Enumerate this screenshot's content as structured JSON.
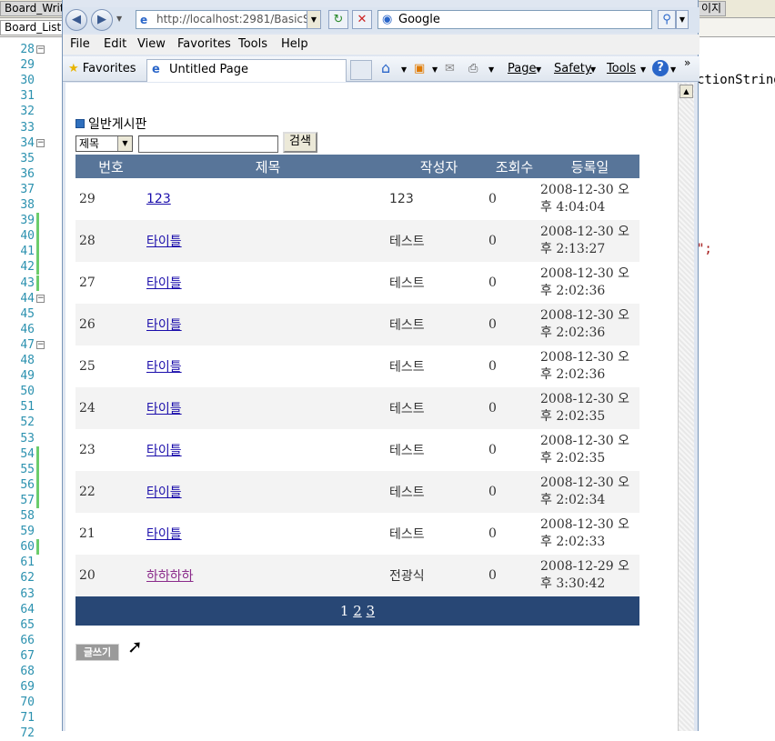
{
  "editor": {
    "tabs": [
      "Board_Writ",
      "Board_List"
    ],
    "right_tab": "이지",
    "line_numbers": [
      "28",
      "29",
      "30",
      "31",
      "32",
      "33",
      "34",
      "35",
      "36",
      "37",
      "38",
      "39",
      "40",
      "41",
      "42",
      "43",
      "44",
      "45",
      "46",
      "47",
      "48",
      "49",
      "50",
      "51",
      "52",
      "53",
      "54",
      "55",
      "56",
      "57",
      "58",
      "59",
      "60",
      "61",
      "62",
      "63",
      "64",
      "65",
      "66",
      "67",
      "68",
      "69",
      "70",
      "71",
      "72"
    ],
    "code_fragment_1": "ctionString",
    "code_fragment_2": "\";"
  },
  "browser": {
    "address": "http://localhost:2981/BasicS",
    "search_text": "Google",
    "menu": [
      "File",
      "Edit",
      "View",
      "Favorites",
      "Tools",
      "Help"
    ],
    "favorites_label": "Favorites",
    "tab_title": "Untitled Page",
    "command_bar": [
      "Page",
      "Safety",
      "Tools"
    ]
  },
  "board": {
    "title": "일반게시판",
    "search_field_option": "제목",
    "search_button": "검색",
    "columns": [
      "번호",
      "제목",
      "작성자",
      "조회수",
      "등록일"
    ],
    "rows": [
      {
        "num": "29",
        "title": "123",
        "writer": "123",
        "hits": "0",
        "date": "2008-12-30 오후 4:04:04"
      },
      {
        "num": "28",
        "title": "타이틀",
        "writer": "테스트",
        "hits": "0",
        "date": "2008-12-30 오후 2:13:27"
      },
      {
        "num": "27",
        "title": "타이틀",
        "writer": "테스트",
        "hits": "0",
        "date": "2008-12-30 오후 2:02:36"
      },
      {
        "num": "26",
        "title": "타이틀",
        "writer": "테스트",
        "hits": "0",
        "date": "2008-12-30 오후 2:02:36"
      },
      {
        "num": "25",
        "title": "타이틀",
        "writer": "테스트",
        "hits": "0",
        "date": "2008-12-30 오후 2:02:36"
      },
      {
        "num": "24",
        "title": "타이틀",
        "writer": "테스트",
        "hits": "0",
        "date": "2008-12-30 오후 2:02:35"
      },
      {
        "num": "23",
        "title": "타이틀",
        "writer": "테스트",
        "hits": "0",
        "date": "2008-12-30 오후 2:02:35"
      },
      {
        "num": "22",
        "title": "타이틀",
        "writer": "테스트",
        "hits": "0",
        "date": "2008-12-30 오후 2:02:34"
      },
      {
        "num": "21",
        "title": "타이틀",
        "writer": "테스트",
        "hits": "0",
        "date": "2008-12-30 오후 2:02:33"
      },
      {
        "num": "20",
        "title": "하하하하",
        "writer": "전광식",
        "hits": "0",
        "date": "2008-12-29 오후 3:30:42"
      }
    ],
    "pager": {
      "current": "1",
      "pages": [
        "2",
        "3"
      ]
    },
    "write_button": "글쓰기"
  }
}
